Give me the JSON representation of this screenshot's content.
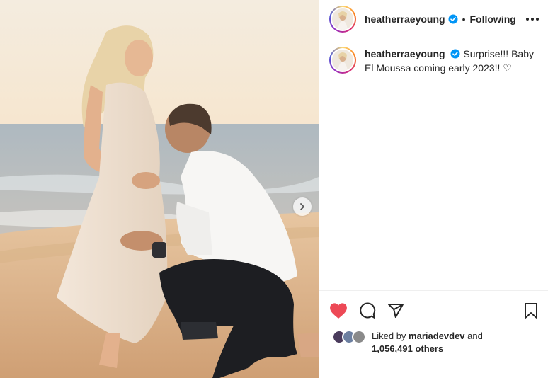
{
  "post": {
    "author": "heatherraeyoung",
    "separator": "•",
    "follow_status": "Following",
    "caption": "Surprise!!! Baby El Moussa coming early 2023!! ♡",
    "likes_prefix": "Liked by",
    "liked_by_user": "mariadevdev",
    "likes_join": "and",
    "likes_count": "1,056,491 others"
  },
  "colors": {
    "like_active": "#ed4956",
    "verified": "#0095f6",
    "text": "#262626"
  },
  "icons": {
    "more": "more-options-icon",
    "like": "heart-icon",
    "comment": "comment-icon",
    "share": "share-icon",
    "save": "bookmark-icon",
    "next": "chevron-right-icon"
  }
}
